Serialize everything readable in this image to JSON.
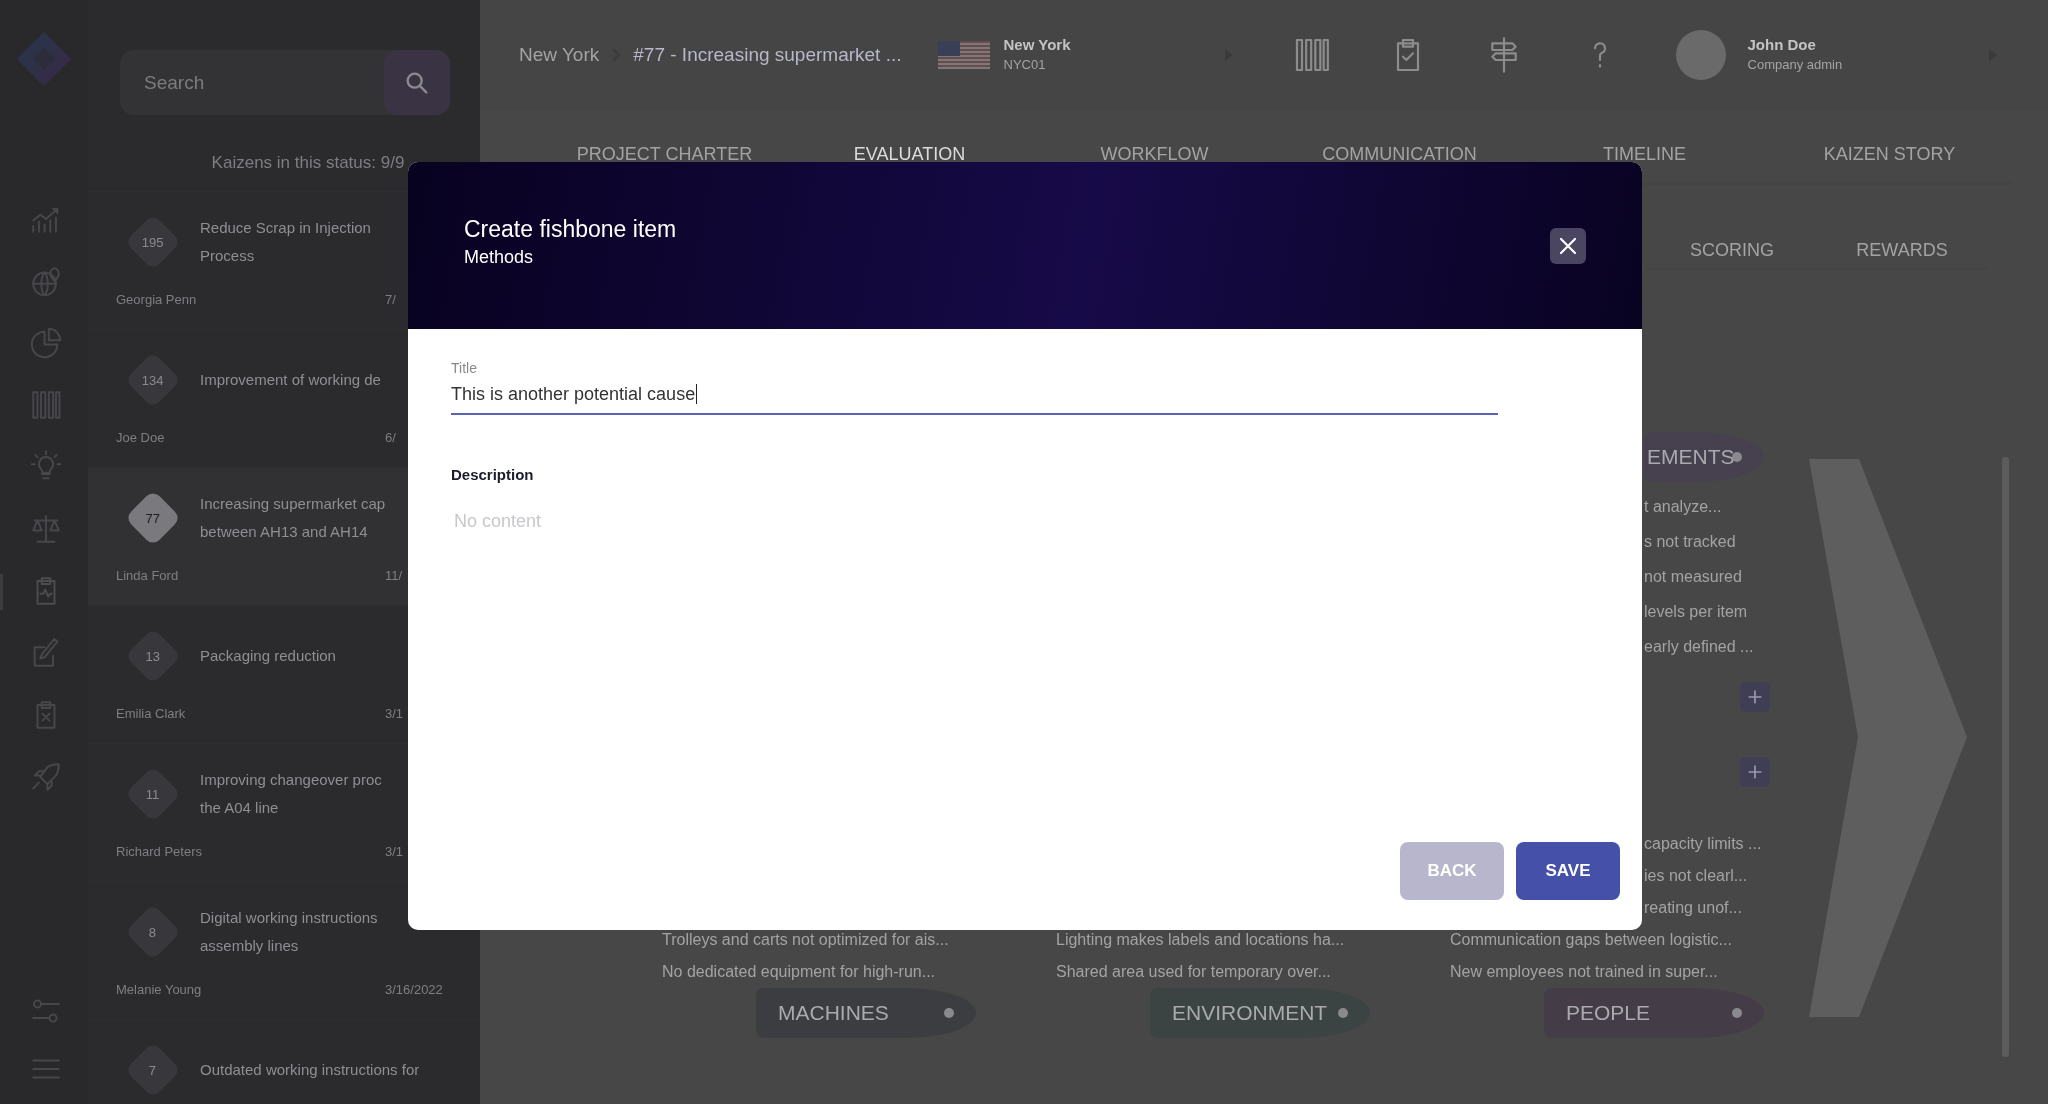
{
  "rail": {
    "items": [
      {
        "kind": "chart",
        "selected": false
      },
      {
        "kind": "globe",
        "selected": false
      },
      {
        "kind": "pie",
        "selected": false
      },
      {
        "kind": "columns",
        "selected": false
      },
      {
        "kind": "bulb",
        "selected": false
      },
      {
        "kind": "scales",
        "selected": false
      },
      {
        "kind": "clipboard-pulse",
        "selected": true
      },
      {
        "kind": "edit",
        "selected": false
      },
      {
        "kind": "clipboard-x",
        "selected": false
      },
      {
        "kind": "rocket",
        "selected": false
      }
    ],
    "bottom_items": [
      {
        "kind": "sliders",
        "selected": false
      },
      {
        "kind": "menu",
        "selected": false
      }
    ]
  },
  "list": {
    "search": {
      "placeholder": "Search"
    },
    "count": "Kaizens in this status: 9/9",
    "items": [
      {
        "number": "195",
        "title_lines": [
          "Reduce Scrap in Injection",
          "Process"
        ],
        "owner": "Georgia Penn",
        "date": "7/",
        "selected": false
      },
      {
        "number": "134",
        "title_lines": [
          "Improvement of working de"
        ],
        "owner": "Joe Doe",
        "date": "6/",
        "selected": false
      },
      {
        "number": "77",
        "title_lines": [
          "Increasing supermarket cap",
          "between AH13 and AH14"
        ],
        "owner": "Linda Ford",
        "date": "11/",
        "selected": true
      },
      {
        "number": "13",
        "title_lines": [
          "Packaging reduction"
        ],
        "owner": "Emilia Clark",
        "date": "3/1",
        "selected": false
      },
      {
        "number": "11",
        "title_lines": [
          "Improving changeover proc",
          "the A04 line"
        ],
        "owner": "Richard Peters",
        "date": "3/1",
        "selected": false
      },
      {
        "number": "8",
        "title_lines": [
          "Digital working instructions",
          "assembly lines"
        ],
        "owner": "Melanie Young",
        "date": "3/16/2022",
        "selected": false
      },
      {
        "number": "7",
        "title_lines": [
          "Outdated working instructions for"
        ],
        "selected": false
      }
    ]
  },
  "topbar": {
    "breadcrumb": [
      "New York",
      "#77 - Increasing supermarket ..."
    ],
    "site": {
      "name": "New York",
      "code": "NYC01"
    },
    "user": {
      "name": "John Doe",
      "role": "Company admin"
    }
  },
  "tabs": [
    {
      "label": "PROJECT CHARTER",
      "selected": false
    },
    {
      "label": "EVALUATION",
      "selected": true
    },
    {
      "label": "WORKFLOW",
      "selected": false
    },
    {
      "label": "COMMUNICATION",
      "selected": false
    },
    {
      "label": "TIMELINE",
      "selected": false
    },
    {
      "label": "KAIZEN STORY",
      "selected": false
    }
  ],
  "subtabs": [
    {
      "label": "SCORING"
    },
    {
      "label": "REWARDS"
    }
  ],
  "fishbone": {
    "top_category": {
      "label": "EMENTS",
      "color": "#46404f",
      "partial_causes": [
        "t analyze...",
        "s not tracked",
        "not measured",
        "levels per item",
        "early defined ..."
      ]
    },
    "bottom_categories": [
      {
        "label": "MACHINES",
        "color": "#3c3d40",
        "causes": [
          "Trolleys and carts not optimized for ais...",
          "No dedicated equipment for high-run..."
        ]
      },
      {
        "label": "ENVIRONMENT",
        "color": "#3b4442",
        "causes": [
          "Lighting makes labels and locations ha...",
          "Shared area used for temporary over..."
        ]
      },
      {
        "label": "PEOPLE",
        "color": "#443c47",
        "partial_causes": [
          "capacity limits ...",
          "ies not clearl...",
          "reating unof..."
        ],
        "causes": [
          "Communication gaps between logistic...",
          "New employees not trained in super..."
        ]
      }
    ]
  },
  "modal": {
    "title": "Create fishbone item",
    "subtitle": "Methods",
    "title_field": {
      "label": "Title",
      "value": "This is another potential cause"
    },
    "description_field": {
      "label": "Description",
      "placeholder": "No content"
    },
    "buttons": [
      {
        "label": "BACK",
        "kind": "secondary"
      },
      {
        "label": "SAVE",
        "kind": "primary"
      }
    ]
  }
}
